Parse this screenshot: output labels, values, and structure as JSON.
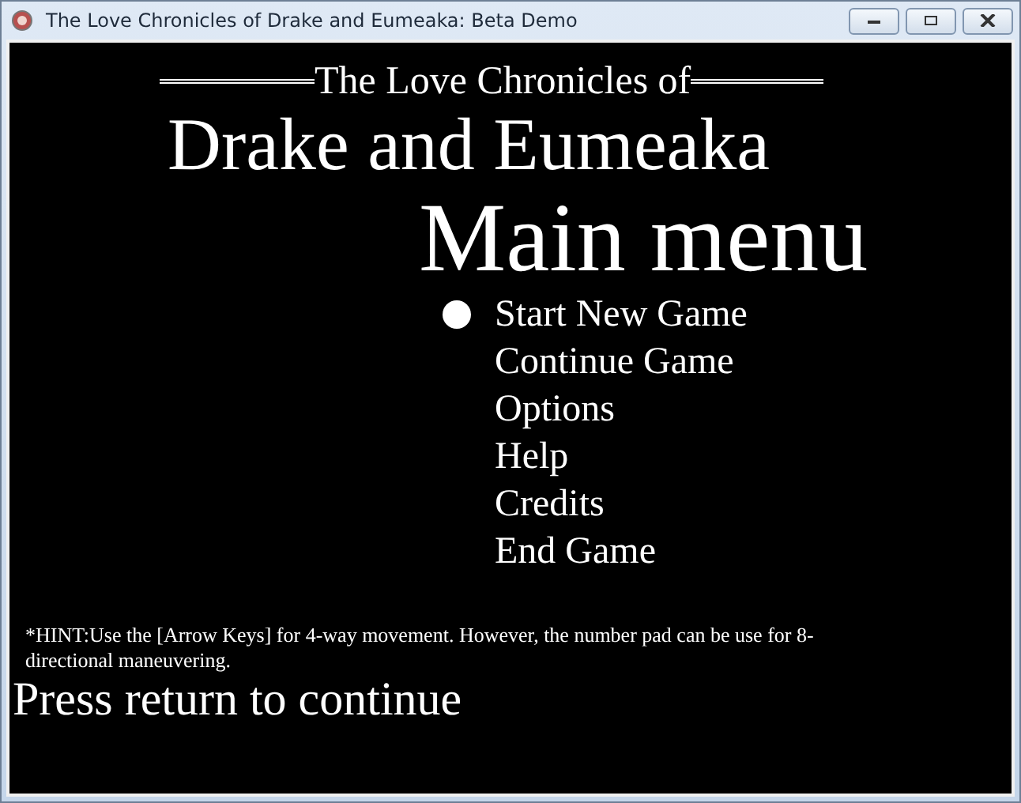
{
  "window": {
    "title": "The Love Chronicles of Drake and Eumeaka: Beta Demo"
  },
  "title": {
    "line_1": "The Love Chronicles of",
    "line_2": "Drake and Eumeaka"
  },
  "menu": {
    "heading": "Main menu",
    "items": [
      {
        "label": "Start New Game",
        "selected": true
      },
      {
        "label": "Continue Game",
        "selected": false
      },
      {
        "label": "Options",
        "selected": false
      },
      {
        "label": "Help",
        "selected": false
      },
      {
        "label": "Credits",
        "selected": false
      },
      {
        "label": "End Game",
        "selected": false
      }
    ]
  },
  "hint": "*HINT:Use the [Arrow Keys] for 4-way movement. However, the number pad can be use for 8-directional maneuvering.",
  "prompt": "Press return to continue"
}
